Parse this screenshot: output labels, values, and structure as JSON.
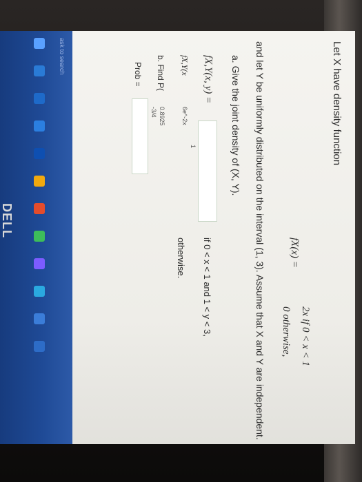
{
  "problem": {
    "intro": "Let X have density function",
    "fx_lhs": "fX(x) =",
    "fx_cases": [
      "2x   if 0 < x < 1",
      "0   otherwise,"
    ],
    "y_statement": "and let Y be uniformly distributed on the interval (1, 3). Assume that X and Y are independent.",
    "part_a": "a. Give the joint density of (X, Y).",
    "joint_label": "fX,Y(x, y) =",
    "joint_condition": "if 0 < x < 1 and 1 < y < 3,",
    "joint_otherwise": "otherwise.",
    "joint_annot_1": "1",
    "joint_annot_2": "fX,Y(x",
    "joint_annot_3": "6e^-2x",
    "part_b": "b. Find P(",
    "part_b_annot_1": "0.8925",
    "part_b_annot_2": "-3/4",
    "prob_label": "Prob ="
  },
  "taskbar": {
    "search_hint": "ask to search",
    "brand": "DELL"
  }
}
